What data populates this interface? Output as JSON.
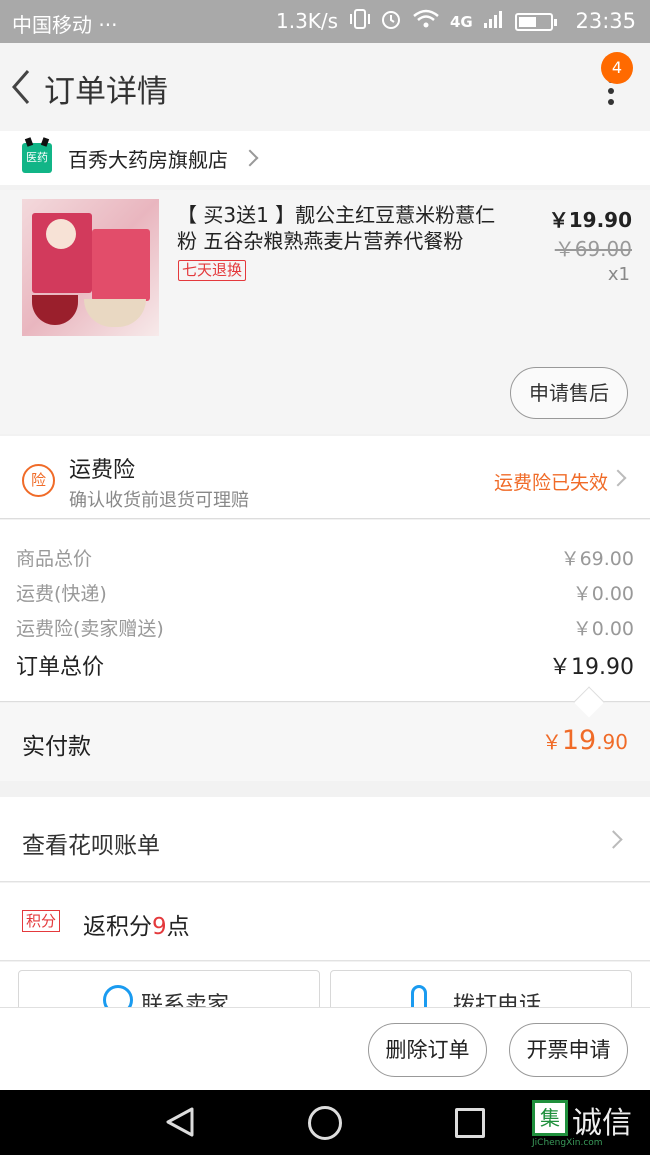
{
  "status_bar": {
    "carrier": "中国移动 ···",
    "net_speed": "1.3K/s",
    "network": "4G",
    "time": "23:35"
  },
  "nav": {
    "title": "订单详情",
    "badge_count": "4"
  },
  "shop": {
    "logo_text": "医药",
    "name": "百秀大药房旗舰店"
  },
  "product": {
    "title": "【 买3送1 】靓公主红豆薏米粉薏仁粉 五谷杂粮熟燕麦片营养代餐粉",
    "tag": "七天退换",
    "price": "￥19.90",
    "original_price": "￥69.00",
    "quantity": "x1",
    "after_sale_button": "申请售后"
  },
  "insurance": {
    "icon_text": "险",
    "title": "运费险",
    "subtitle": "确认收货前退货可理赔",
    "status": "运费险已失效"
  },
  "totals": [
    {
      "label": "商品总价",
      "value": "￥69.00"
    },
    {
      "label": "运费(快递)",
      "value": "￥0.00"
    },
    {
      "label": "运费险(卖家赠送)",
      "value": "￥0.00"
    },
    {
      "label": "订单总价",
      "value": "￥19.90"
    }
  ],
  "paid": {
    "label": "实付款",
    "currency": "￥",
    "integer": "19",
    "decimal": ".90"
  },
  "huabei": {
    "label": "查看花呗账单"
  },
  "points": {
    "tag": "积分",
    "prefix": "返积分",
    "number": "9",
    "suffix": "点"
  },
  "contact": {
    "seller_label": "联系卖家",
    "phone_label": "拨打电话"
  },
  "actions": {
    "delete_label": "删除订单",
    "invoice_label": "开票申请"
  },
  "watermark": {
    "logo_char": "集",
    "text": "诚信",
    "sub": "JiChengXin.com"
  },
  "colors": {
    "accent_orange": "#f06b28",
    "badge_orange": "#ff6a00",
    "tag_red": "#e4393c"
  }
}
